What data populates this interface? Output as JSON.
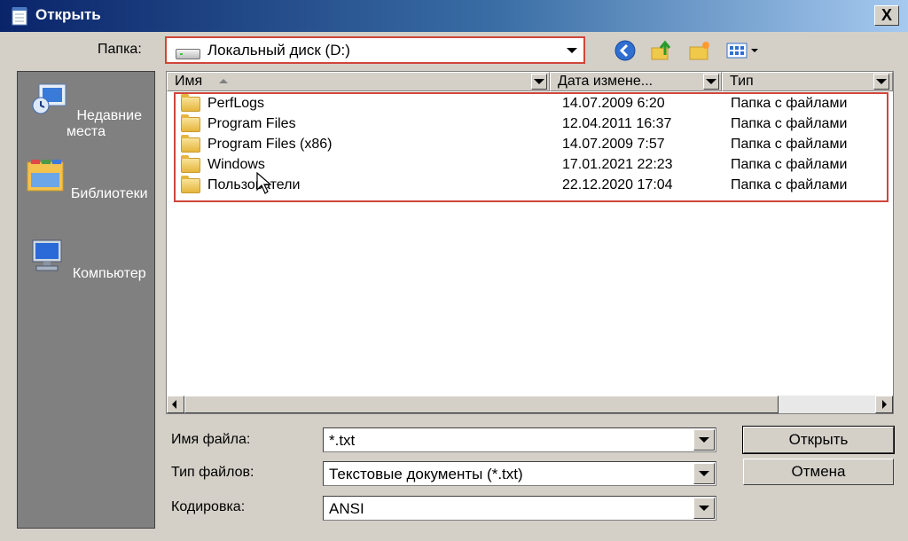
{
  "window": {
    "title": "Открыть",
    "close_symbol": "X"
  },
  "folder": {
    "label": "Папка:",
    "value": "Локальный диск (D:)",
    "icon": "drive-icon"
  },
  "toolbar": {
    "icons": [
      "back-icon",
      "up-folder-icon",
      "new-folder-icon",
      "view-menu-icon"
    ]
  },
  "places": [
    {
      "label": "Недавние места",
      "icon": "recent-places-icon"
    },
    {
      "label": "Библиотеки",
      "icon": "libraries-icon"
    },
    {
      "label": "Компьютер",
      "icon": "computer-icon"
    }
  ],
  "list": {
    "columns": {
      "name": "Имя",
      "date": "Дата измене...",
      "type": "Тип"
    },
    "rows": [
      {
        "name": "PerfLogs",
        "date": "14.07.2009 6:20",
        "type": "Папка с файлами"
      },
      {
        "name": "Program Files",
        "date": "12.04.2011 16:37",
        "type": "Папка с файлами"
      },
      {
        "name": "Program Files (x86)",
        "date": "14.07.2009 7:57",
        "type": "Папка с файлами"
      },
      {
        "name": "Windows",
        "date": "17.01.2021 22:23",
        "type": "Папка с файлами"
      },
      {
        "name": "Пользователи",
        "date": "22.12.2020 17:04",
        "type": "Папка с файлами"
      }
    ]
  },
  "form": {
    "filename_label": "Имя файла:",
    "filename_value": "*.txt",
    "filetype_label": "Тип файлов:",
    "filetype_value": "Текстовые документы (*.txt)",
    "encoding_label": "Кодировка:",
    "encoding_value": "ANSI"
  },
  "buttons": {
    "open": "Открыть",
    "cancel": "Отмена"
  },
  "colors": {
    "highlight_border": "#d0453a",
    "titlebar_start": "#0a246a",
    "panel_gray": "#808080"
  }
}
